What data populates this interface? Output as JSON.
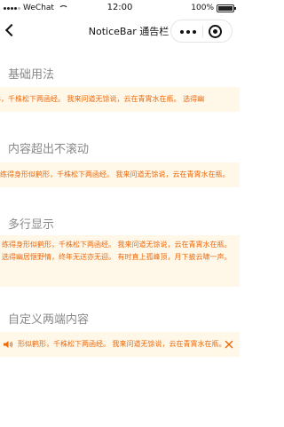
{
  "status_bar": {
    "carrier": "WeChat",
    "time": "12:00",
    "battery": "100%",
    "battery_level": 1.0
  },
  "nav": {
    "title": "NoticeBar 通告栏"
  },
  "sections": {
    "basic": {
      "title": "基础用法",
      "text": "鹤形，千株松下两函经。 我来问道无馀说，云在青霄水在瓶。 选得幽"
    },
    "overflow": {
      "title": "内容超出不滚动",
      "text": "练得身形似鹤形，千株松下两函经。 我来问道无馀说，云在青霄水在瓶。"
    },
    "multiline": {
      "title": "多行显示",
      "text": "练得身形似鹤形，千株松下两函经。 我来问道无馀说，云在青霄水在瓶。 选得幽居惬野情，终年无送亦无迎。 有时直上孤峰顶，月下披云啸一声。"
    },
    "custom": {
      "title": "自定义两端内容",
      "text": "形似鹤形，千株松下两函经。 我来问道无馀说，云在青霄水在瓶。",
      "left_icon": "volume-icon",
      "right_icon": "close-icon"
    }
  },
  "colors": {
    "notice_bg": "#fff7e8",
    "notice_text": "#ed6a0c",
    "section_title": "#888888"
  }
}
